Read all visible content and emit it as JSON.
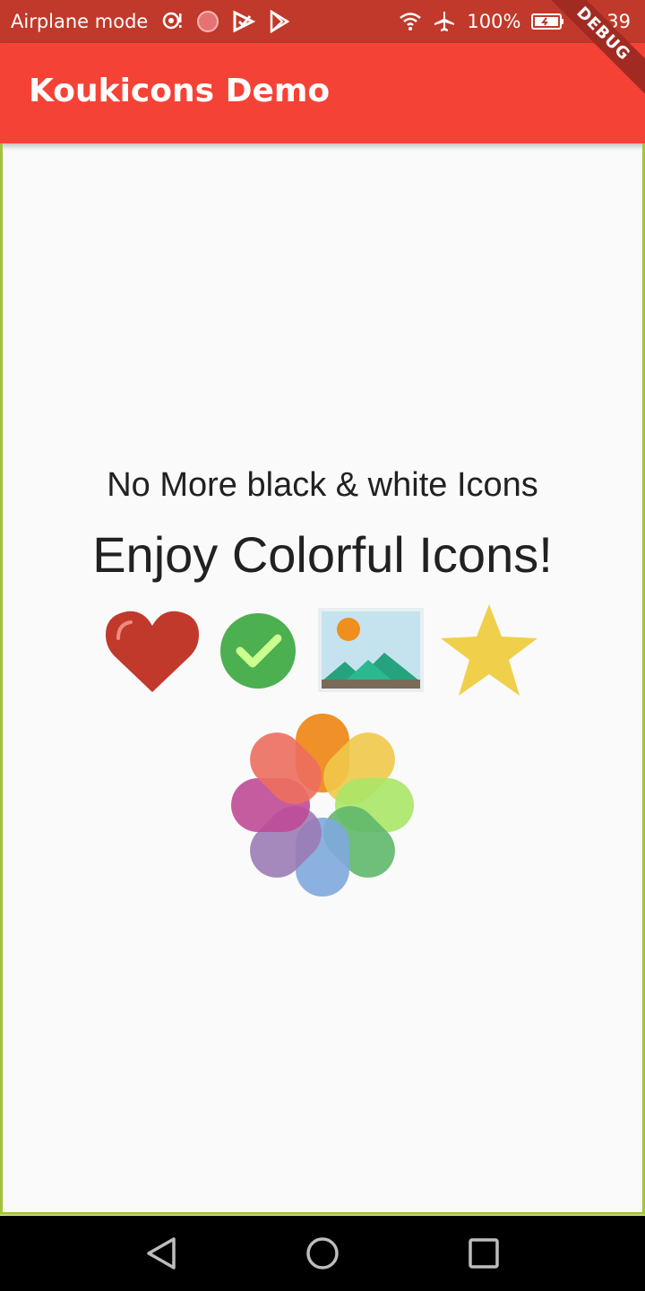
{
  "status_bar": {
    "left_text": "Airplane mode",
    "battery": "100%",
    "time": "10:39"
  },
  "app_bar": {
    "title": "Koukicons Demo",
    "debug_banner": "DEBUG"
  },
  "content": {
    "subtitle": "No More black & white Icons",
    "headline": "Enjoy Colorful Icons!"
  },
  "icons": [
    "heart-icon",
    "check-circle-icon",
    "landscape-picture-icon",
    "star-icon",
    "photos-flower-icon"
  ],
  "colors": {
    "status_bar": "#c0392b",
    "app_bar": "#f44336",
    "background": "#fafafa",
    "heart": "#c0392b",
    "check": "#4caf50",
    "star": "#f0d04b"
  }
}
